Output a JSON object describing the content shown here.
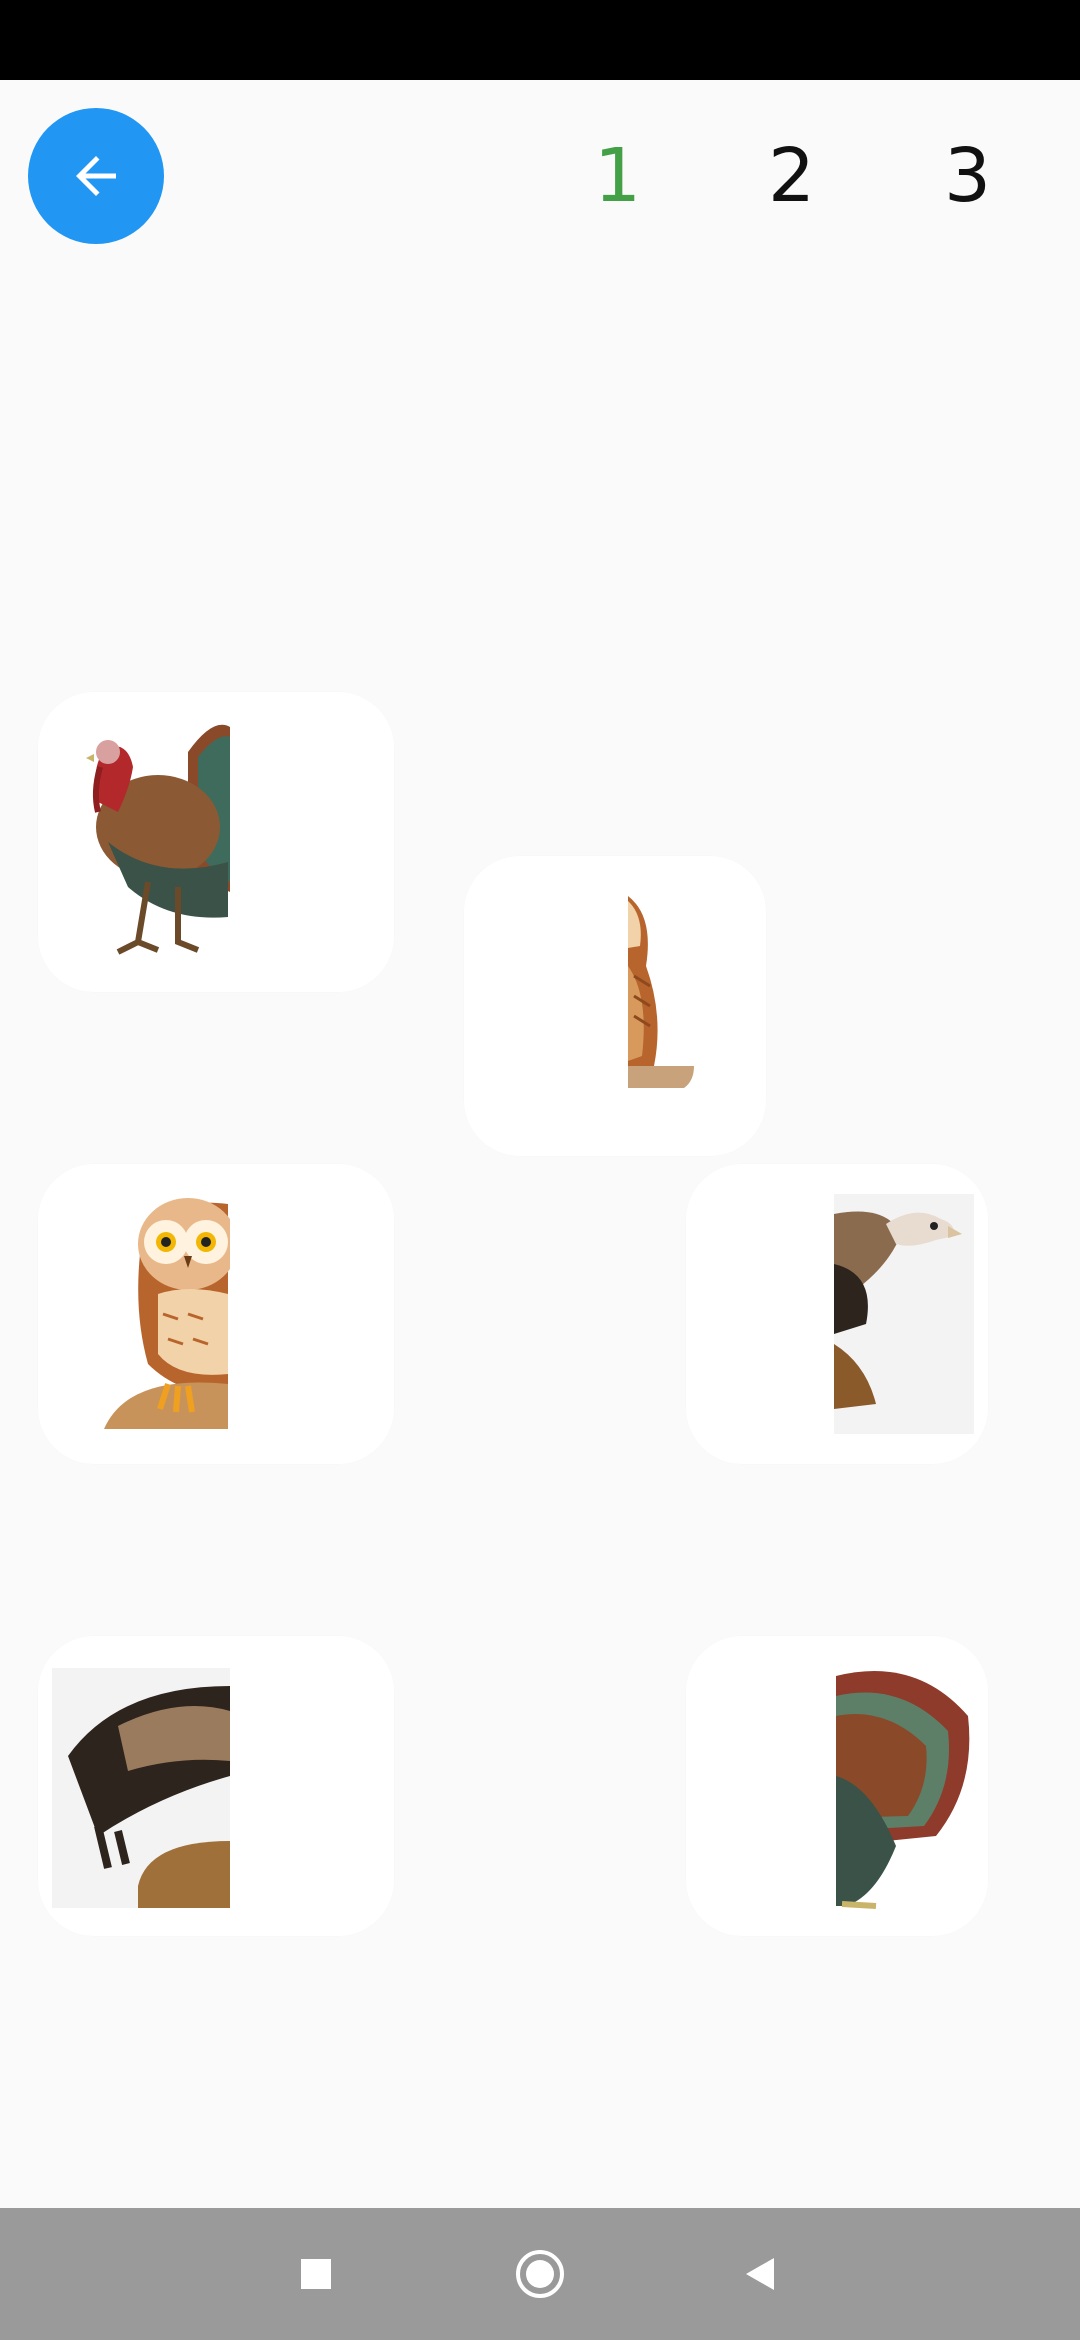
{
  "header": {
    "back_icon": "arrow-left-icon",
    "levels": [
      {
        "label": "1",
        "active": true
      },
      {
        "label": "2",
        "active": false
      },
      {
        "label": "3",
        "active": false
      }
    ],
    "accent_color": "#2196f3",
    "active_level_color": "#43a047"
  },
  "cards": [
    {
      "subject": "turkey",
      "half": "left"
    },
    {
      "subject": "owl",
      "half": "right"
    },
    {
      "subject": "owl",
      "half": "left"
    },
    {
      "subject": "vulture",
      "half": "right"
    },
    {
      "subject": "vulture",
      "half": "left"
    },
    {
      "subject": "turkey",
      "half": "right"
    }
  ],
  "navigation": {
    "recents_icon": "square-icon",
    "home_icon": "circle-icon",
    "back_icon": "triangle-back-icon"
  }
}
